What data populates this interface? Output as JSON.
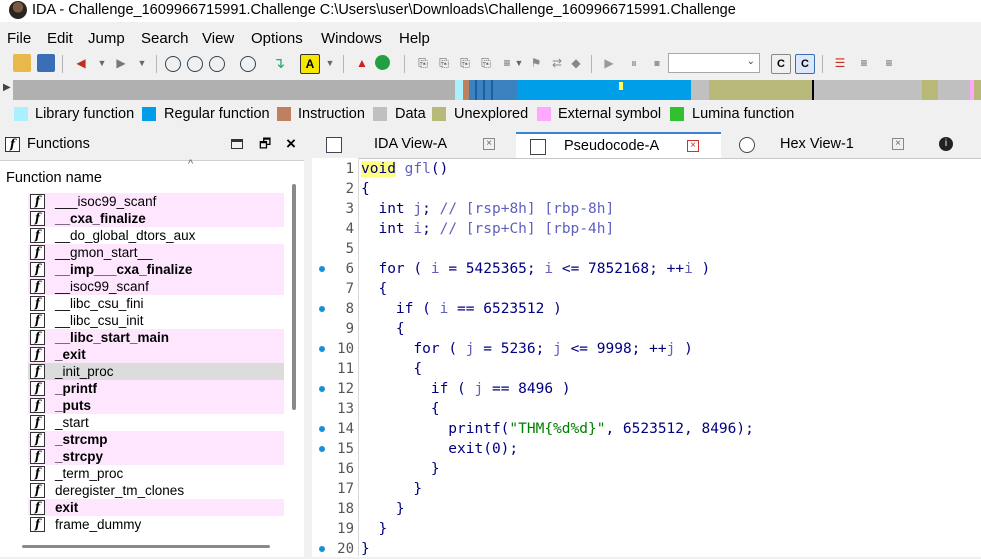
{
  "window": {
    "title": "IDA - Challenge_1609966715991.Challenge C:\\Users\\user\\Downloads\\Challenge_1609966715991.Challenge"
  },
  "menu": [
    "File",
    "Edit",
    "Jump",
    "Search",
    "View",
    "Options",
    "Windows",
    "Help"
  ],
  "legend": [
    {
      "label": "Library function",
      "color": "#aaf0ff"
    },
    {
      "label": "Regular function",
      "color": "#009de8"
    },
    {
      "label": "Instruction",
      "color": "#c08060"
    },
    {
      "label": "Data",
      "color": "#c0c0c0"
    },
    {
      "label": "Unexplored",
      "color": "#b8b878"
    },
    {
      "label": "External symbol",
      "color": "#ffa8ff"
    },
    {
      "label": "Lumina function",
      "color": "#30c030"
    }
  ],
  "functions_panel": {
    "title": "Functions",
    "column_header": "Function name",
    "items": [
      {
        "name": "___isoc99_scanf",
        "kind": "lib"
      },
      {
        "name": "__cxa_finalize",
        "kind": "lib-bold"
      },
      {
        "name": "__do_global_dtors_aux",
        "kind": "normal"
      },
      {
        "name": "__gmon_start__",
        "kind": "lib"
      },
      {
        "name": "__imp___cxa_finalize",
        "kind": "lib-bold"
      },
      {
        "name": "__isoc99_scanf",
        "kind": "lib"
      },
      {
        "name": "__libc_csu_fini",
        "kind": "normal"
      },
      {
        "name": "__libc_csu_init",
        "kind": "normal"
      },
      {
        "name": "__libc_start_main",
        "kind": "lib-bold"
      },
      {
        "name": "_exit",
        "kind": "lib-bold"
      },
      {
        "name": "_init_proc",
        "kind": "selected"
      },
      {
        "name": "_printf",
        "kind": "lib-bold"
      },
      {
        "name": "_puts",
        "kind": "lib-bold"
      },
      {
        "name": "_start",
        "kind": "normal"
      },
      {
        "name": "_strcmp",
        "kind": "lib-bold"
      },
      {
        "name": "_strcpy",
        "kind": "lib-bold"
      },
      {
        "name": "_term_proc",
        "kind": "normal"
      },
      {
        "name": "deregister_tm_clones",
        "kind": "normal"
      },
      {
        "name": "exit",
        "kind": "lib-bold"
      },
      {
        "name": "frame_dummy",
        "kind": "normal"
      }
    ]
  },
  "tabs": [
    {
      "label": "IDA View-A",
      "active": false
    },
    {
      "label": "Pseudocode-A",
      "active": true
    },
    {
      "label": "Hex View-1",
      "active": false
    }
  ],
  "code": {
    "line_numbers": [
      "1",
      "2",
      "3",
      "4",
      "5",
      "6",
      "7",
      "8",
      "9",
      "10",
      "11",
      "12",
      "13",
      "14",
      "15",
      "16",
      "17",
      "18",
      "19",
      "20"
    ],
    "breakpoint_lines": [
      6,
      8,
      10,
      12,
      14,
      15,
      20
    ],
    "lines": [
      "void gfl()",
      "{",
      "  int j; // [rsp+8h] [rbp-8h]",
      "  int i; // [rsp+Ch] [rbp-4h]",
      "",
      "  for ( i = 5425365; i <= 7852168; ++i )",
      "  {",
      "    if ( i == 6523512 )",
      "    {",
      "      for ( j = 5236; j <= 9998; ++j )",
      "      {",
      "        if ( j == 8496 )",
      "        {",
      "          printf(\"THM{%d%d}\", 6523512, 8496);",
      "          exit(0);",
      "        }",
      "      }",
      "    }",
      "  }",
      "}"
    ]
  }
}
